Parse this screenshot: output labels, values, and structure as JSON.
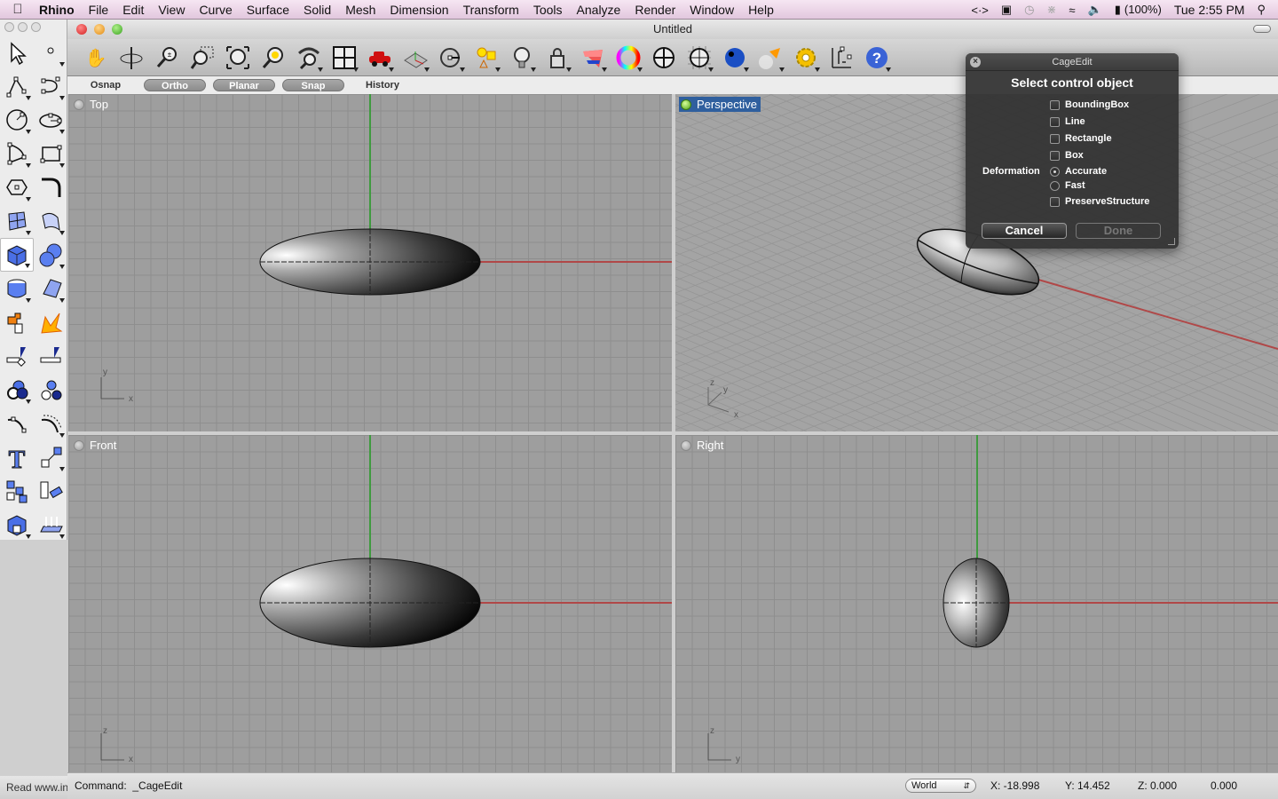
{
  "menubar": {
    "app": "Rhino",
    "items": [
      "File",
      "Edit",
      "View",
      "Curve",
      "Surface",
      "Solid",
      "Mesh",
      "Dimension",
      "Transform",
      "Tools",
      "Analyze",
      "Render",
      "Window",
      "Help"
    ],
    "status": {
      "battery": "(100%)",
      "clock": "Tue 2:55 PM"
    }
  },
  "window": {
    "title": "Untitled"
  },
  "toolbar": {
    "icons": [
      "pan-icon",
      "rotate-view-icon",
      "zoom-dynamic-icon",
      "zoom-window-icon",
      "zoom-extents-icon",
      "zoom-selected-icon",
      "undo-view-icon",
      "four-viewports-icon",
      "car-icon",
      "cplane-icon",
      "osnap-icon",
      "shapes-icon",
      "light-icon",
      "lock-icon",
      "color-palette-icon",
      "color-wheel-icon",
      "wireframe-sphere-icon",
      "grid-sphere-icon",
      "render-sphere-icon",
      "spotlight-icon",
      "gear-settings-icon",
      "dimension-icon",
      "help-icon"
    ]
  },
  "modes": {
    "osnap": "Osnap",
    "ortho": "Ortho",
    "planar": "Planar",
    "snap": "Snap",
    "history": "History"
  },
  "viewports": {
    "top": {
      "label": "Top",
      "axes": [
        "y",
        "x"
      ]
    },
    "perspective": {
      "label": "Perspective",
      "axes": [
        "z",
        "y",
        "x"
      ]
    },
    "front": {
      "label": "Front",
      "axes": [
        "z",
        "x"
      ]
    },
    "right": {
      "label": "Right",
      "axes": [
        "z",
        "y"
      ]
    }
  },
  "palette": {
    "tools": [
      "select-icon",
      "point-icon",
      "polyline-icon",
      "curve-icon",
      "circle-icon",
      "ellipse-icon",
      "arc-icon",
      "rectangle-icon",
      "polygon-icon",
      "fillet-icon",
      "surface-corner-icon",
      "surface-edge-icon",
      "box-icon",
      "sphere-icon",
      "cylinder-icon",
      "surface-patch-icon",
      "join-icon",
      "explode-icon",
      "trim-icon",
      "split-icon",
      "boolean-union-icon",
      "group-icon",
      "extend-curve-icon",
      "offset-curve-icon",
      "text-icon",
      "scale-icon",
      "array-icon",
      "rotate-icon",
      "solid-box-icon",
      "extrude-icon"
    ],
    "selected": "box-icon"
  },
  "read_bar": "Read www.in",
  "command": {
    "label": "Command:",
    "value": "_CageEdit"
  },
  "coords": {
    "space": "World",
    "x": "X: -18.998",
    "y": "Y: 14.452",
    "z": "Z: 0.000",
    "extra": "0.000"
  },
  "dialog": {
    "title": "CageEdit",
    "heading": "Select control object",
    "options": [
      {
        "label": "BoundingBox",
        "type": "checkbox",
        "checked": false
      },
      {
        "label": "Line",
        "type": "checkbox",
        "checked": false
      },
      {
        "label": "Rectangle",
        "type": "checkbox",
        "checked": false
      },
      {
        "label": "Box",
        "type": "checkbox",
        "checked": false
      }
    ],
    "deformation_label": "Deformation",
    "deformation": [
      {
        "label": "Accurate",
        "selected": true
      },
      {
        "label": "Fast",
        "selected": false
      }
    ],
    "preserve": {
      "label": "PreserveStructure",
      "checked": false
    },
    "cancel": "Cancel",
    "done": "Done"
  },
  "colors": {
    "x_axis": "#b04848",
    "y_axis": "#3f9a3f",
    "active_viewport": "#2f5f9e"
  }
}
